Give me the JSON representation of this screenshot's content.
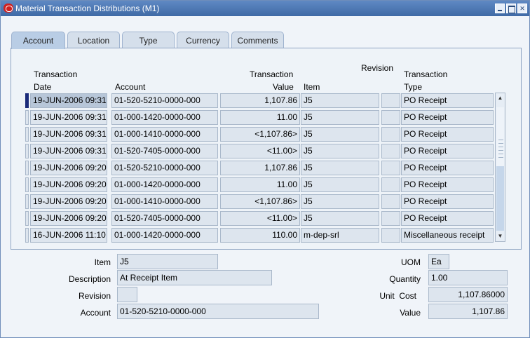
{
  "window": {
    "title": "Material Transaction Distributions (M1)"
  },
  "tabs": [
    "Account",
    "Location",
    "Type",
    "Currency",
    "Comments"
  ],
  "table": {
    "headers": {
      "date": "Transaction Date",
      "date_l1": "Transaction",
      "date_l2": "Date",
      "account": "Account",
      "value_l1": "Transaction",
      "value_l2": "Value",
      "item": "Item",
      "revision": "Revision",
      "type_l1": "Transaction",
      "type_l2": "Type"
    },
    "rows": [
      {
        "date": "19-JUN-2006 09:31",
        "account": "01-520-5210-0000-000",
        "value": "1,107.86",
        "item": "J5",
        "revision": "",
        "type": "PO Receipt"
      },
      {
        "date": "19-JUN-2006 09:31",
        "account": "01-000-1420-0000-000",
        "value": "11.00",
        "item": "J5",
        "revision": "",
        "type": "PO Receipt"
      },
      {
        "date": "19-JUN-2006 09:31",
        "account": "01-000-1410-0000-000",
        "value": "<1,107.86>",
        "item": "J5",
        "revision": "",
        "type": "PO Receipt"
      },
      {
        "date": "19-JUN-2006 09:31",
        "account": "01-520-7405-0000-000",
        "value": "<11.00>",
        "item": "J5",
        "revision": "",
        "type": "PO Receipt"
      },
      {
        "date": "19-JUN-2006 09:20",
        "account": "01-520-5210-0000-000",
        "value": "1,107.86",
        "item": "J5",
        "revision": "",
        "type": "PO Receipt"
      },
      {
        "date": "19-JUN-2006 09:20",
        "account": "01-000-1420-0000-000",
        "value": "11.00",
        "item": "J5",
        "revision": "",
        "type": "PO Receipt"
      },
      {
        "date": "19-JUN-2006 09:20",
        "account": "01-000-1410-0000-000",
        "value": "<1,107.86>",
        "item": "J5",
        "revision": "",
        "type": "PO Receipt"
      },
      {
        "date": "19-JUN-2006 09:20",
        "account": "01-520-7405-0000-000",
        "value": "<11.00>",
        "item": "J5",
        "revision": "",
        "type": "PO Receipt"
      },
      {
        "date": "16-JUN-2006 11:10",
        "account": "01-000-1420-0000-000",
        "value": "110.00",
        "item": "m-dep-srl",
        "revision": "",
        "type": "Miscellaneous receipt"
      }
    ]
  },
  "detail": {
    "item": {
      "label": "Item",
      "value": "J5"
    },
    "description": {
      "label": "Description",
      "value": "At Receipt Item"
    },
    "revision": {
      "label": "Revision",
      "value": ""
    },
    "account": {
      "label": "Account",
      "value": "01-520-5210-0000-000"
    },
    "uom": {
      "label": "UOM",
      "value": "Ea"
    },
    "quantity": {
      "label": "Quantity",
      "value": "1.00"
    },
    "unit_cost": {
      "label": "Unit  Cost",
      "value": "1,107.86000"
    },
    "value": {
      "label": "Value",
      "value": "1,107.86"
    }
  },
  "colors": {
    "titlebar": "#4f79b5",
    "active_tab": "#b9cde5",
    "field_bg": "#dde5ee",
    "row_indicator": "#1b2b7a"
  }
}
